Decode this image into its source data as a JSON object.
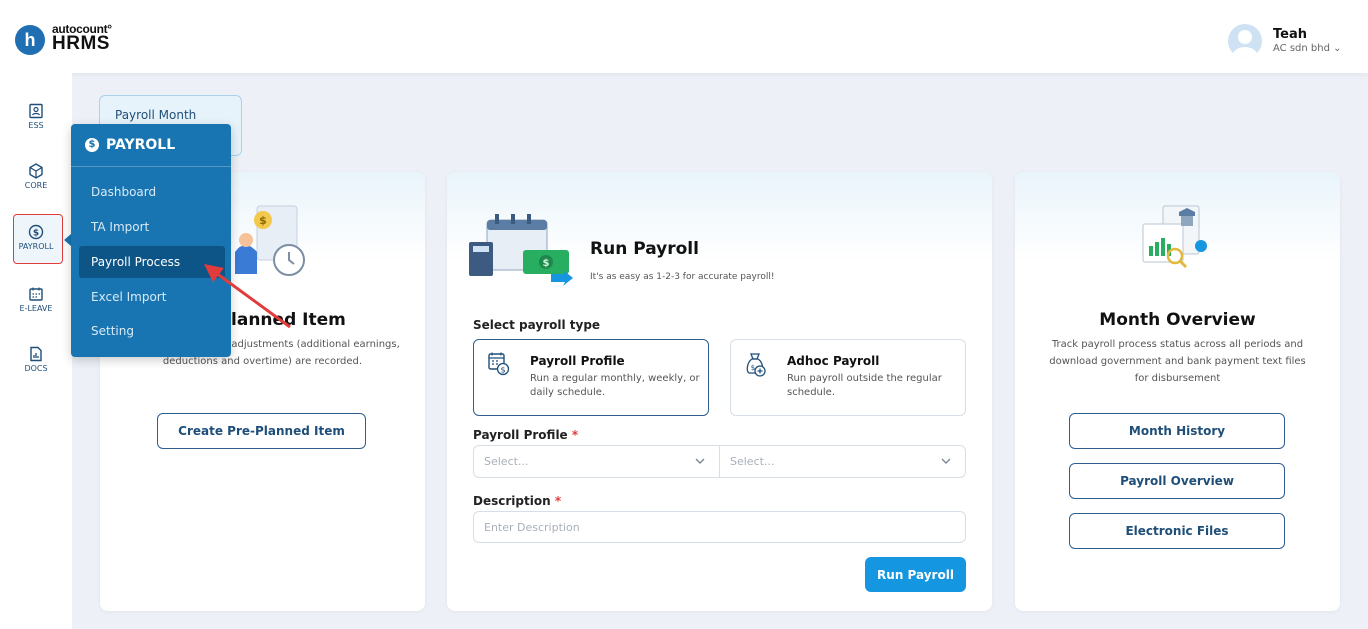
{
  "header": {
    "logo_letter": "h",
    "logo_line1": "autocount°",
    "logo_line2": "HRMS",
    "user_name": "Teah",
    "user_org": "AC sdn bhd ⌄"
  },
  "rail": {
    "items": [
      {
        "label": "ESS",
        "icon": "ess-icon"
      },
      {
        "label": "CORE",
        "icon": "core-icon"
      },
      {
        "label": "PAYROLL",
        "icon": "payroll-icon"
      },
      {
        "label": "E-LEAVE",
        "icon": "calendar-icon"
      },
      {
        "label": "DOCS",
        "icon": "docs-icon"
      }
    ]
  },
  "month_tab": "Payroll Month",
  "flyout": {
    "title": "PAYROLL",
    "items": [
      "Dashboard",
      "TA Import",
      "Payroll Process",
      "Excel Import",
      "Setting"
    ],
    "active": "Payroll Process"
  },
  "card1": {
    "title": "Pre-Planned Item",
    "title_visible": "lanned Item",
    "description": "Ensure all necessary adjustments (additional earnings, deductions and overtime) are recorded.",
    "desc_visible_1": "nsure all necessary adjustments",
    "desc_visible_2": "(additional earnings, deductions and overtime) are",
    "desc_visible_3": "recorded.",
    "button": "Create Pre-Planned Item"
  },
  "run_payroll": {
    "title": "Run Payroll",
    "subtitle": "It's as easy as 1-2-3 for accurate payroll!",
    "type_label": "Select payroll type",
    "types": [
      {
        "title": "Payroll Profile",
        "desc": "Run a regular monthly, weekly, or daily schedule.",
        "selected": true
      },
      {
        "title": "Adhoc Payroll",
        "desc": "Run payroll outside the regular schedule.",
        "selected": false
      }
    ],
    "profile_label": "Payroll Profile",
    "required_mark": "*",
    "select1_placeholder": "Select...",
    "select2_placeholder": "Select...",
    "description_label": "Description",
    "description_placeholder": "Enter Description",
    "button": "Run Payroll"
  },
  "month_overview": {
    "title": "Month Overview",
    "desc_1": "Track payroll process status across all periods and",
    "desc_2": "download government and bank payment text files",
    "desc_3": "for disbursement",
    "buttons": [
      "Month History",
      "Payroll Overview",
      "Electronic Files"
    ]
  },
  "colors": {
    "accent": "#1975b1",
    "primary_button": "#1596e0",
    "highlight_border": "#e23b3b"
  }
}
